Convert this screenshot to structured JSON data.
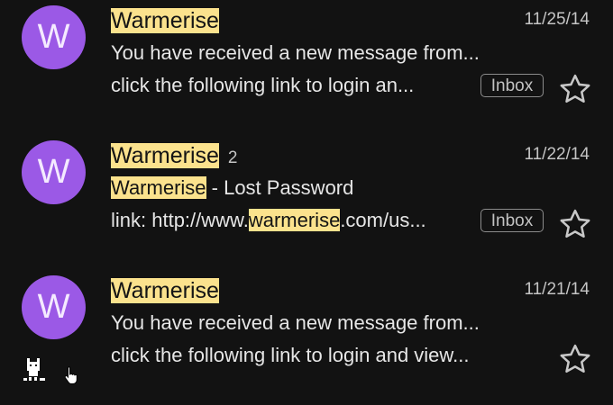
{
  "emails": [
    {
      "avatar_letter": "W",
      "sender": "Warmerise",
      "thread_count": "",
      "date": "11/25/14",
      "subject": "You have received a new message from...",
      "preview": "click the following link to login an...",
      "label": "Inbox",
      "starred": false
    },
    {
      "avatar_letter": "W",
      "sender": "Warmerise",
      "thread_count": "2",
      "date": "11/22/14",
      "subject_prefix": "Warmerise",
      "subject_rest": " - Lost Password",
      "preview_before": "link: http://www.",
      "preview_highlight": "warmerise",
      "preview_after": ".com/us...",
      "label": "Inbox",
      "starred": false
    },
    {
      "avatar_letter": "W",
      "sender": "Warmerise",
      "thread_count": "",
      "date": "11/21/14",
      "subject": "You have received a new message from...",
      "preview": "click the following link to login and view...",
      "starred": false
    }
  ],
  "colors": {
    "background": "#121212",
    "avatar": "#9b59e6",
    "search_highlight": "#fbe28d"
  },
  "icons": [
    "star-outline-icon",
    "pixel-cat-icon",
    "hand-pointer-icon"
  ]
}
